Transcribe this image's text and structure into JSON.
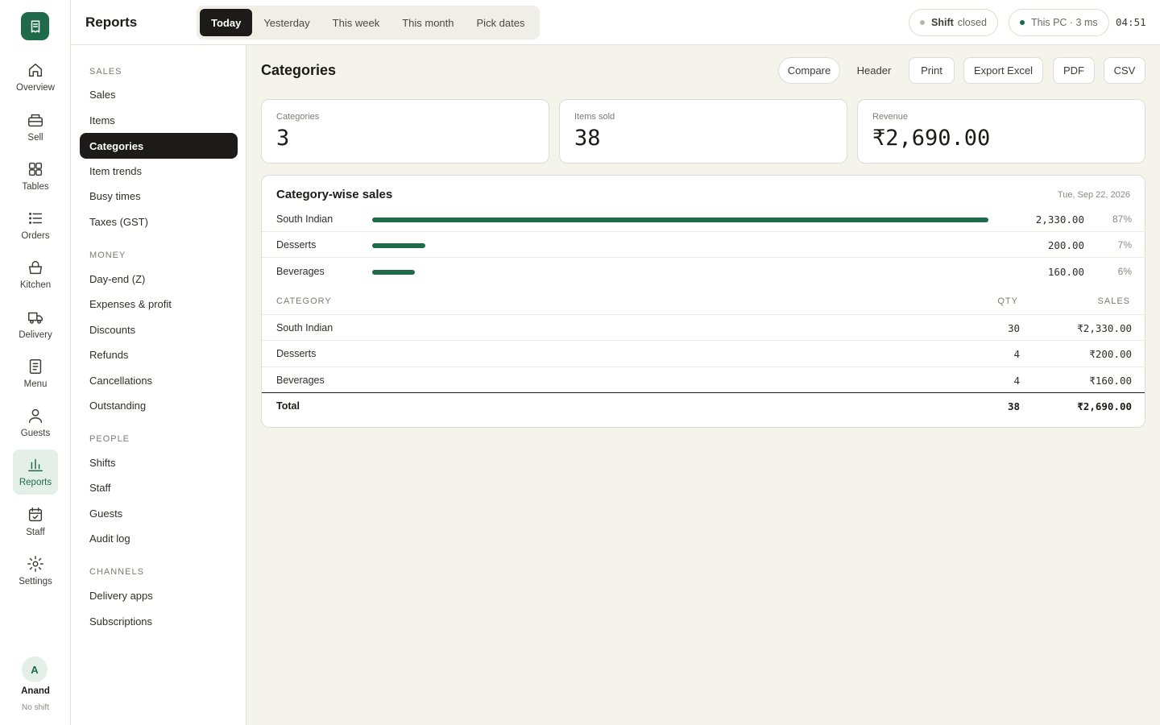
{
  "app": {
    "page_title": "Reports"
  },
  "date_range": {
    "tabs": [
      "Today",
      "Yesterday",
      "This week",
      "This month",
      "Pick dates"
    ],
    "active": "Today"
  },
  "status": {
    "shift_label": "Shift",
    "shift_state": "closed",
    "connection": "This PC · 3 ms",
    "clock": "04:51",
    "colors": {
      "shift_dot": "#b7b5ae",
      "connection_dot": "#1e6a4b"
    }
  },
  "rail": {
    "items": [
      {
        "label": "Overview",
        "icon": "home-icon"
      },
      {
        "label": "Sell",
        "icon": "register-icon"
      },
      {
        "label": "Tables",
        "icon": "grid-icon"
      },
      {
        "label": "Orders",
        "icon": "list-icon"
      },
      {
        "label": "Kitchen",
        "icon": "basket-icon"
      },
      {
        "label": "Delivery",
        "icon": "truck-icon"
      },
      {
        "label": "Menu",
        "icon": "menu-doc-icon"
      },
      {
        "label": "Guests",
        "icon": "person-icon"
      },
      {
        "label": "Reports",
        "icon": "bar-chart-icon"
      },
      {
        "label": "Staff",
        "icon": "calendar-check-icon"
      },
      {
        "label": "Settings",
        "icon": "gear-icon"
      }
    ],
    "active": "Reports",
    "user": {
      "initial": "A",
      "name": "Anand",
      "status": "No shift"
    }
  },
  "subnav": {
    "sections": [
      {
        "title": "SALES",
        "items": [
          "Sales",
          "Items",
          "Categories",
          "Item trends",
          "Busy times",
          "Taxes (GST)"
        ]
      },
      {
        "title": "MONEY",
        "items": [
          "Day-end (Z)",
          "Expenses & profit",
          "Discounts",
          "Refunds",
          "Cancellations",
          "Outstanding"
        ]
      },
      {
        "title": "PEOPLE",
        "items": [
          "Shifts",
          "Staff",
          "Guests",
          "Audit log"
        ]
      },
      {
        "title": "CHANNELS",
        "items": [
          "Delivery apps",
          "Subscriptions"
        ]
      }
    ],
    "active": "Categories"
  },
  "main": {
    "title": "Categories",
    "toolbar": {
      "compare": "Compare",
      "header": "Header",
      "print": "Print",
      "excel": "Export Excel",
      "pdf": "PDF",
      "csv": "CSV"
    },
    "kpis": [
      {
        "label": "Categories",
        "value": "3"
      },
      {
        "label": "Items sold",
        "value": "38"
      },
      {
        "label": "Revenue",
        "value": "₹2,690.00"
      }
    ],
    "card": {
      "title": "Category-wise sales",
      "date": "Tue, Sep 22, 2026",
      "bars": [
        {
          "name": "South Indian",
          "value": "2,330.00",
          "pct": "87%",
          "fraction": 1.0
        },
        {
          "name": "Desserts",
          "value": "200.00",
          "pct": "7%",
          "fraction": 0.086
        },
        {
          "name": "Beverages",
          "value": "160.00",
          "pct": "6%",
          "fraction": 0.069
        }
      ],
      "table": {
        "headers": {
          "category": "CATEGORY",
          "qty": "QTY",
          "sales": "SALES"
        },
        "rows": [
          {
            "category": "South Indian",
            "qty": "30",
            "sales": "₹2,330.00"
          },
          {
            "category": "Desserts",
            "qty": "4",
            "sales": "₹200.00"
          },
          {
            "category": "Beverages",
            "qty": "4",
            "sales": "₹160.00"
          }
        ],
        "total": {
          "category": "Total",
          "qty": "38",
          "sales": "₹2,690.00"
        }
      },
      "colors": {
        "bar": "#1e6a4b"
      }
    }
  }
}
